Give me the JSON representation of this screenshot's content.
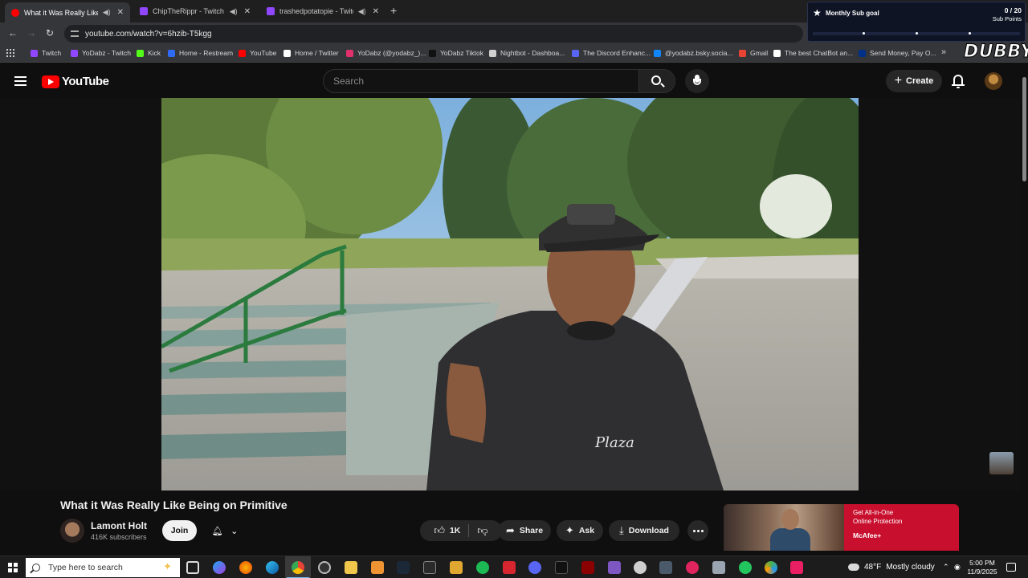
{
  "browser": {
    "tabs": [
      {
        "title": "What it Was Really Like Bei",
        "active": true,
        "audio": true,
        "favicon_color": "#ff0000"
      },
      {
        "title": "ChipTheRippr - Twitch",
        "active": false,
        "audio": true,
        "favicon_color": "#9146ff"
      },
      {
        "title": "trashedpotatopie - Twitch",
        "active": false,
        "audio": true,
        "favicon_color": "#9146ff"
      }
    ],
    "new_tab": "+",
    "url": "youtube.com/watch?v=6hzib-T5kgg",
    "bookmarks": [
      {
        "label": "Twitch",
        "icon_color": "#9146ff"
      },
      {
        "label": "YoDabz - Twitch",
        "icon_color": "#9146ff"
      },
      {
        "label": "Kick",
        "icon_color": "#53fc18"
      },
      {
        "label": "Home - Restream",
        "icon_color": "#2e6cf6"
      },
      {
        "label": "YouTube",
        "icon_color": "#ff0000"
      },
      {
        "label": "Home / Twitter",
        "icon_color": "#ffffff"
      },
      {
        "label": "YoDabz (@yodabz_)...",
        "icon_color": "#e1306c"
      },
      {
        "label": "YoDabz Tiktok",
        "icon_color": "#111111"
      },
      {
        "label": "Nightbot - Dashboa...",
        "icon_color": "#cfcfcf"
      },
      {
        "label": "The Discord Enhanc...",
        "icon_color": "#5865f2"
      },
      {
        "label": "@yodabz.bsky.socia...",
        "icon_color": "#1185fe"
      },
      {
        "label": "Gmail",
        "icon_color": "#ea4335"
      },
      {
        "label": "The best ChatBot an...",
        "icon_color": "#ffffff"
      },
      {
        "label": "Send Money, Pay O...",
        "icon_color": "#003087"
      }
    ],
    "more": "»"
  },
  "overlay": {
    "sub_goal_title": "Monthly Sub goal",
    "sub_goal_count": "0 / 20",
    "sub_goal_unit": "Sub Points",
    "progress": 0,
    "brand": "DUBBY"
  },
  "youtube": {
    "logo_text": "YouTube",
    "search_placeholder": "Search",
    "create_label": "Create",
    "video": {
      "title": "What it Was Really Like Being on Primitive",
      "channel": "Lamont Holt",
      "subscribers": "416K subscribers",
      "join": "Join",
      "likes": "1K",
      "share": "Share",
      "ask": "Ask",
      "download": "Download"
    },
    "ad": {
      "line1": "Get All-in-One",
      "line2": "Online Protection",
      "brand": "McAfee+"
    }
  },
  "taskbar": {
    "search_placeholder": "Type here to search",
    "weather_temp": "48°F",
    "weather_desc": "Mostly cloudy",
    "time": "5:00 PM",
    "date": "11/9/2025"
  }
}
